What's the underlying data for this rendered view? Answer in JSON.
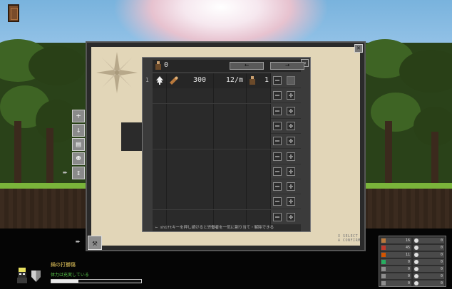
{
  "dialog": {
    "worker_count": "0",
    "prev_label": "←",
    "next_label": "→",
    "close_label": "✕",
    "row": {
      "number": "1",
      "amount": "300",
      "rate": "12/m",
      "assigned": "1"
    },
    "footer_hint": "← shiftキーを押し続けると労働者を一気に割り当て・解除できる"
  },
  "map": {
    "close_label": "✕",
    "hint_select": "X SELECT",
    "hint_confirm": "A CONFIRM"
  },
  "hud": {
    "character_name": "鍋の打擲傷",
    "status_text": "体力は充実している",
    "health_fraction": 0.3
  },
  "items": [
    {
      "icon": "log-icon",
      "color": "#b9793c",
      "value": "16"
    },
    {
      "icon": "cloud-icon",
      "color": "#e0e0e0",
      "value": "0"
    },
    {
      "icon": "meat-icon",
      "color": "#c0392b",
      "value": "45"
    },
    {
      "icon": "cloud-icon",
      "color": "#e0e0e0",
      "value": "0"
    },
    {
      "icon": "fruit-icon",
      "color": "#d35400",
      "value": "11"
    },
    {
      "icon": "cloud-icon",
      "color": "#e0e0e0",
      "value": "0"
    },
    {
      "icon": "leaf-icon",
      "color": "#27ae60",
      "value": "0"
    },
    {
      "icon": "cloud-icon",
      "color": "#e0e0e0",
      "value": "0"
    },
    {
      "icon": "stone-icon",
      "color": "#8e8e8e",
      "value": "0"
    },
    {
      "icon": "cloud-icon",
      "color": "#e0e0e0",
      "value": "0"
    },
    {
      "icon": "stone-icon",
      "color": "#8e8e8e",
      "value": "0"
    },
    {
      "icon": "cloud-icon",
      "color": "#e0e0e0",
      "value": "0"
    },
    {
      "icon": "stone-icon",
      "color": "#8e8e8e",
      "value": "0"
    },
    {
      "icon": "cloud-icon",
      "color": "#e0e0e0",
      "value": "0"
    }
  ]
}
